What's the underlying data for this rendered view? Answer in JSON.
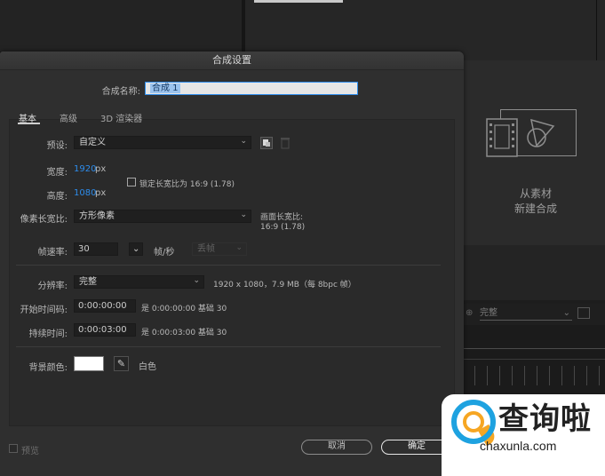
{
  "background": {
    "comp_panel": {
      "new_from_footage": "从素材\n新建合成"
    },
    "footer_select": "完整"
  },
  "dialog": {
    "title": "合成设置",
    "comp_name_label": "合成名称:",
    "comp_name_value": "合成 1",
    "tabs": [
      {
        "label": "基本",
        "active": true
      },
      {
        "label": "高级",
        "active": false
      },
      {
        "label": "3D 渲染器",
        "active": false
      }
    ],
    "preset": {
      "label": "预设:",
      "value": "自定义"
    },
    "width": {
      "label": "宽度:",
      "value": "1920",
      "unit": "px"
    },
    "height": {
      "label": "高度:",
      "value": "1080",
      "unit": "px"
    },
    "lock_aspect": {
      "label": "锁定长宽比为 16:9 (1.78)",
      "checked": false
    },
    "pixel_aspect": {
      "label": "像素长宽比:",
      "value": "方形像素"
    },
    "frame_aspect": {
      "label": "画面长宽比:",
      "value": "16:9 (1.78)"
    },
    "frame_rate": {
      "label": "帧速率:",
      "value": "30",
      "unit": "帧/秒",
      "drop_frame": "丢帧"
    },
    "resolution": {
      "label": "分辨率:",
      "value": "完整",
      "info": "1920 x 1080，7.9 MB（每 8bpc 帧）"
    },
    "start_timecode": {
      "label": "开始时间码:",
      "value": "0:00:00:00",
      "info": "是 0:00:00:00  基础 30"
    },
    "duration": {
      "label": "持续时间:",
      "value": "0:00:03:00",
      "info": "是 0:00:03:00  基础 30"
    },
    "bg_color": {
      "label": "背景颜色:",
      "color": "#ffffff",
      "name": "白色"
    },
    "preview": {
      "label": "预览",
      "checked": false
    },
    "cancel_button": "取消",
    "ok_button": "确定"
  },
  "watermark": {
    "text": "查询啦",
    "url": "chaxunla.com"
  },
  "colors": {
    "accent": "#2d8ceb",
    "dialog_bg": "#2f2f2f",
    "app_bg": "#1d1d1d"
  }
}
